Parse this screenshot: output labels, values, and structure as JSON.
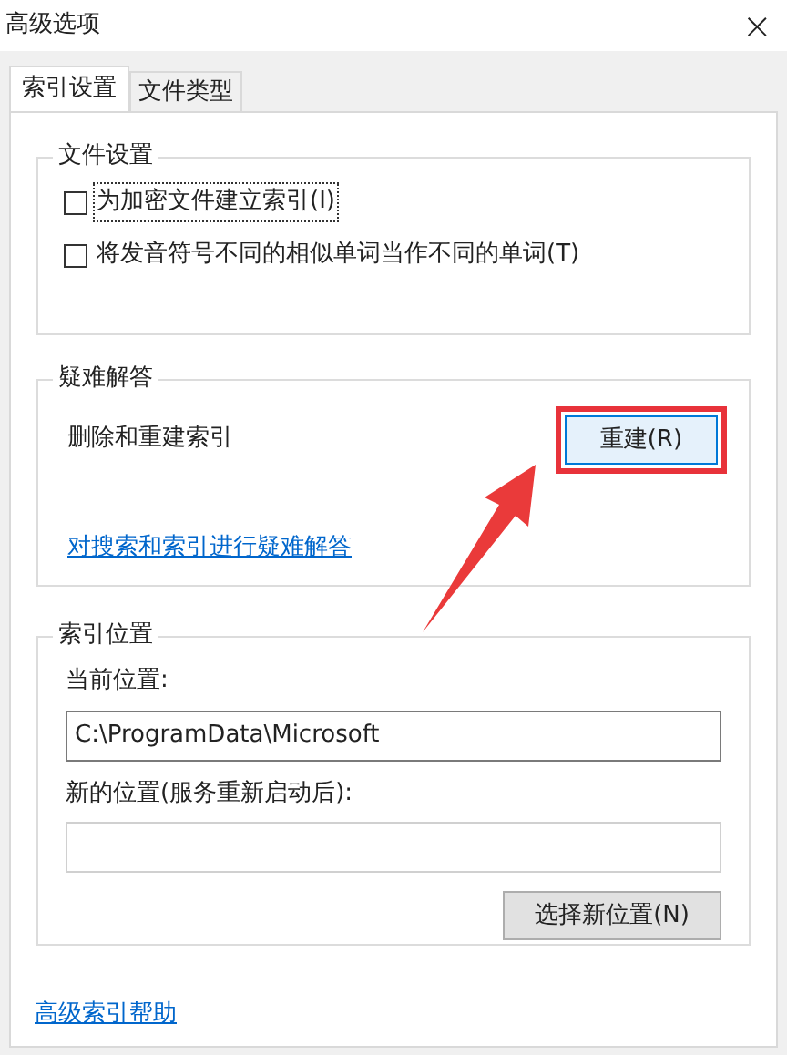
{
  "window": {
    "title": "高级选项",
    "close": "×"
  },
  "tabs": [
    {
      "label": "索引设置",
      "selected": true
    },
    {
      "label": "文件类型",
      "selected": false
    }
  ],
  "file_settings": {
    "title": "文件设置",
    "options": [
      {
        "label": "为加密文件建立索引(I)",
        "checked": false,
        "focused": true
      },
      {
        "label": "将发音符号不同的相似单词当作不同的单词(T)",
        "checked": false,
        "focused": false
      }
    ]
  },
  "troubleshooting": {
    "title": "疑难解答",
    "rebuild_label": "删除和重建索引",
    "rebuild_button": "重建(R)",
    "link": "对搜索和索引进行疑难解答"
  },
  "index_location": {
    "title": "索引位置",
    "current_label": "当前位置:",
    "current_value": "C:\\ProgramData\\Microsoft",
    "new_label": "新的位置(服务重新启动后):",
    "select_button": "选择新位置(N)"
  },
  "help_link": "高级索引帮助",
  "annotation": {
    "highlight": true,
    "arrow": true
  }
}
